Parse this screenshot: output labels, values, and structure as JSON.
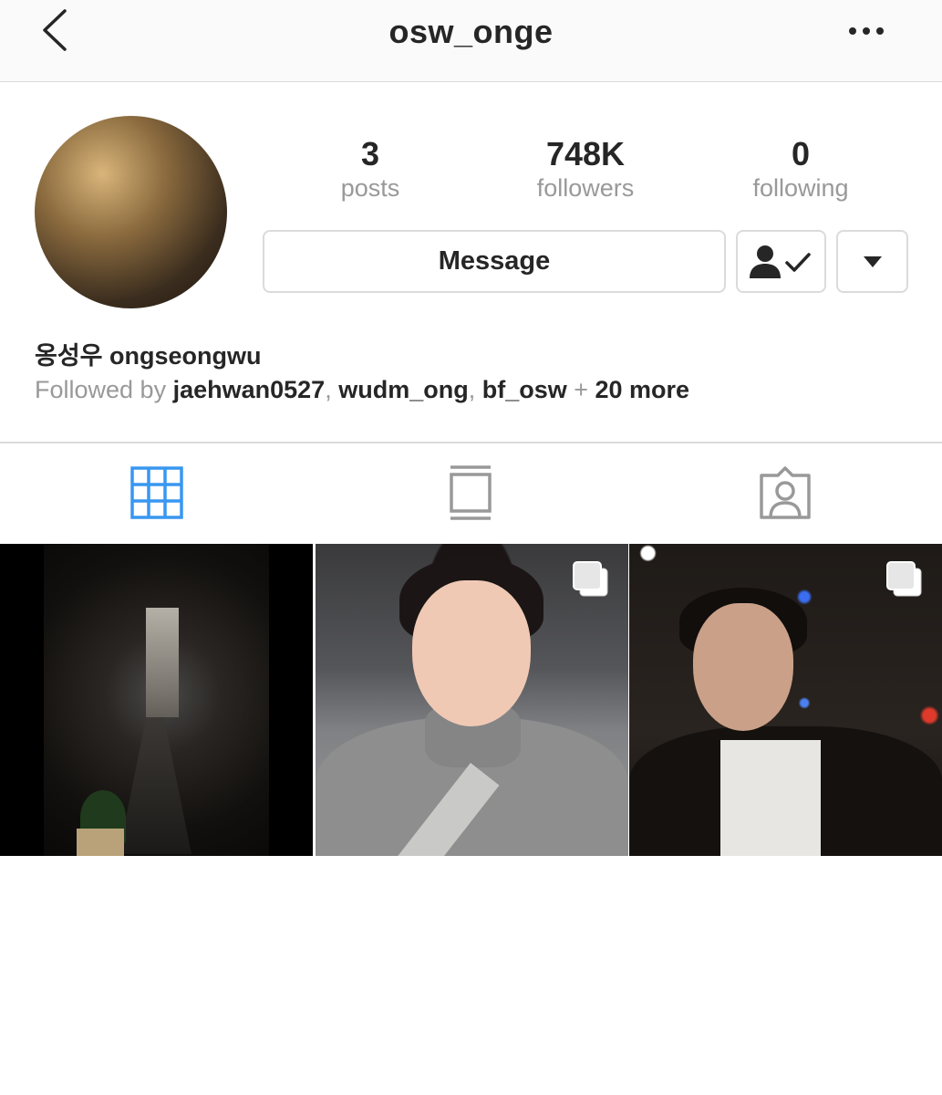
{
  "header": {
    "username": "osw_onge",
    "back_icon": "back-chevron-icon",
    "more_icon": "more-horizontal-icon"
  },
  "profile": {
    "stats": {
      "posts": {
        "count": "3",
        "label": "posts"
      },
      "followers": {
        "count": "748K",
        "label": "followers"
      },
      "following": {
        "count": "0",
        "label": "following"
      }
    },
    "buttons": {
      "message_label": "Message",
      "following_icon": "person-check-icon",
      "dropdown_icon": "caret-down-icon"
    },
    "full_name": "옹성우 ongseongwu",
    "followed_by": {
      "prefix": "Followed by ",
      "users": [
        "jaehwan0527",
        "wudm_ong",
        "bf_osw"
      ],
      "separator": ", ",
      "plus": " + ",
      "more": "20 more"
    }
  },
  "tabs": [
    {
      "name": "grid",
      "icon": "grid-icon",
      "active": true
    },
    {
      "name": "list",
      "icon": "feed-list-icon",
      "active": false
    },
    {
      "name": "tagged",
      "icon": "tagged-person-icon",
      "active": false
    }
  ],
  "posts": [
    {
      "multiple": false
    },
    {
      "multiple": true
    },
    {
      "multiple": true
    }
  ],
  "colors": {
    "active_tab": "#3897f0",
    "inactive_tab": "#999999",
    "text": "#262626",
    "muted": "#999999",
    "border": "#dbdbdb"
  }
}
